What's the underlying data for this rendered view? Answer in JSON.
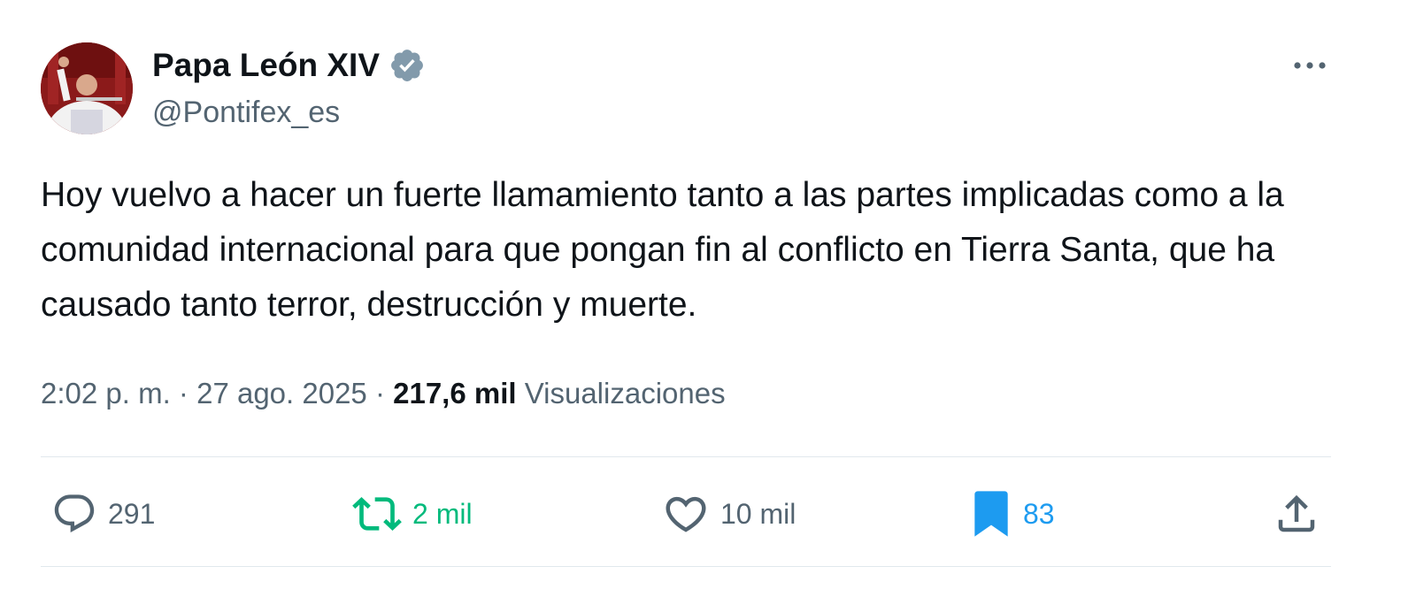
{
  "author": {
    "name": "Papa León XIV",
    "handle": "@Pontifex_es",
    "verified": true,
    "verified_color": "#829aab"
  },
  "tweet": {
    "text": "Hoy vuelvo a hacer un fuerte llamamiento tanto a las partes implicadas como a la comunidad internacional para que pongan fin al conflicto en Tierra Santa, que ha causado tanto terror, destrucción y muerte."
  },
  "meta": {
    "time": "2:02 p. m.",
    "separator": "·",
    "date": "27 ago. 2025",
    "views_count": "217,6 mil",
    "views_label": "Visualizaciones"
  },
  "actions": {
    "replies": "291",
    "reposts": "2 mil",
    "likes": "10 mil",
    "bookmarks": "83"
  },
  "icons": {
    "more": "more-icon",
    "reply": "reply-icon",
    "repost": "repost-icon",
    "like": "heart-icon",
    "bookmark": "bookmark-icon",
    "share": "share-icon"
  },
  "colors": {
    "text": "#0f1419",
    "secondary": "#536471",
    "repost": "#00ba7c",
    "bookmark": "#1d9bf0",
    "divider": "#e1e8ed"
  }
}
